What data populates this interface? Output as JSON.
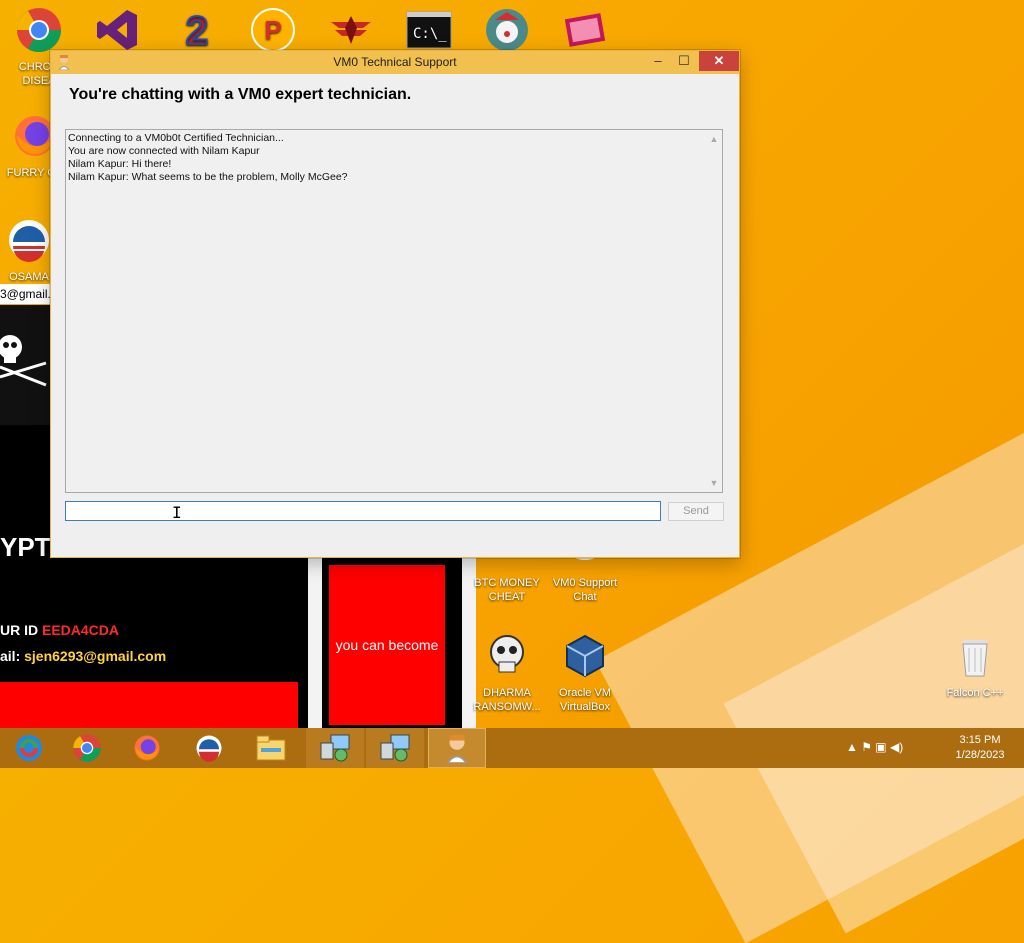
{
  "desktop": {
    "icons": [
      {
        "label": "CHRON DISEA",
        "icon": "chrome-icon"
      },
      {
        "label": "",
        "icon": "visual-studio-icon"
      },
      {
        "label": "",
        "icon": "q2-icon"
      },
      {
        "label": "",
        "icon": "p-orb-icon"
      },
      {
        "label": "",
        "icon": "emblem-icon"
      },
      {
        "label": "",
        "icon": "cmd-icon"
      },
      {
        "label": "",
        "icon": "clown-icon"
      },
      {
        "label": "",
        "icon": "film-icon"
      },
      {
        "label": "FURRY CH",
        "icon": "firefox-icon"
      },
      {
        "label": "OSAMA",
        "icon": "obama-logo-icon"
      },
      {
        "label": "BTC MONEY CHEAT",
        "icon": "btc-icon"
      },
      {
        "label": "VM0 Support Chat",
        "icon": "support-chat-icon"
      },
      {
        "label": "DHARMA RANSOMW...",
        "icon": "skull-icon"
      },
      {
        "label": "Oracle VM VirtualBox",
        "icon": "virtualbox-icon"
      },
      {
        "label": "Falcon C++",
        "icon": "recycle-bin-icon"
      }
    ]
  },
  "ransom_window": {
    "email_strip": "3@gmail.",
    "title_fragment": "YPTE",
    "id_label": "UR ID ",
    "id_value": "EEDA4CDA",
    "mail_label": "ail: ",
    "mail_value": "sjen6293@gmail.com",
    "panel_text": "you can become"
  },
  "chat_window": {
    "title": "VM0 Technical Support",
    "headline": "You're chatting with a VM0 expert technician.",
    "log": [
      "Connecting to a VM0b0t Certified Technician...",
      "You are now connected with Nilam Kapur",
      "Nilam Kapur: Hi there!",
      "Nilam Kapur: What seems to be the problem, Molly McGee?"
    ],
    "input_value": "",
    "send_label": "Send",
    "min_label": "–",
    "max_label": "☐",
    "close_label": "✕"
  },
  "taskbar": {
    "items": [
      {
        "icon": "windows-start-icon",
        "state": "normal"
      },
      {
        "icon": "chrome-icon",
        "state": "normal"
      },
      {
        "icon": "firefox-icon",
        "state": "normal"
      },
      {
        "icon": "obama-logo-icon",
        "state": "normal"
      },
      {
        "icon": "file-explorer-icon",
        "state": "normal"
      },
      {
        "icon": "network-setup-icon",
        "state": "open"
      },
      {
        "icon": "network-setup-icon",
        "state": "open"
      },
      {
        "icon": "support-agent-icon",
        "state": "active"
      }
    ],
    "tray": "▲ ⚑ ▣ ◀)",
    "time": "3:15 PM",
    "date": "1/28/2023"
  },
  "colors": {
    "desktop": "#f6a800",
    "taskbar": "#ac6c10",
    "titlebar": "#f1c04f",
    "close": "#c9423b",
    "ransom_red": "#ff0000"
  }
}
